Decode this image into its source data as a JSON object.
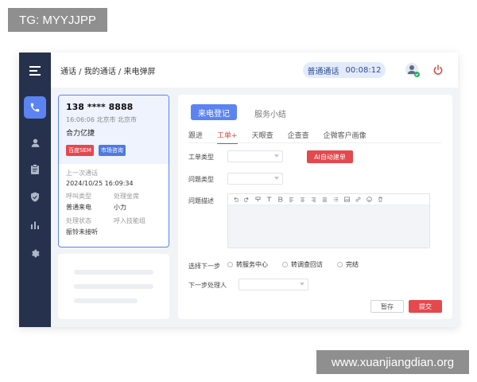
{
  "watermark_top": "TG: MYYJJPP",
  "watermark_bottom": "www.xuanjiangdian.org",
  "topbar": {
    "breadcrumb": "通话 / 我的通话 / 来电弹屏",
    "call_status": "普通通话",
    "call_timer": "00:08:12"
  },
  "sidebar": {
    "icons": [
      "menu-icon",
      "phone-icon",
      "user-icon",
      "clipboard-icon",
      "shield-icon",
      "bar-chart-icon",
      "settings-icon"
    ]
  },
  "caller": {
    "phone": "138 **** 8888",
    "time": "16:06:06",
    "location": "北京市 北京市",
    "company": "合力亿捷",
    "tags": [
      "百度SEM",
      "市场咨询"
    ],
    "last_call_label": "上一次通话",
    "last_call_value": "2024/10/25  16:09:34",
    "call_type_label": "呼叫类型",
    "call_type_value": "普通来电",
    "agent_label": "处理坐席",
    "agent_value": "小力",
    "status_label": "处理状态",
    "status_value": "振铃未接听",
    "skill_group_label": "呼入技能组"
  },
  "main": {
    "tabs": [
      "来电登记",
      "服务小结"
    ],
    "subtabs": [
      "跟进",
      "工单+",
      "天眼查",
      "企查查",
      "企微客户画像"
    ],
    "form": {
      "ticket_type_label": "工单类型",
      "ai_button": "AI自动建单",
      "issue_type_label": "问题类型",
      "issue_desc_label": "问题描述",
      "next_step_label": "选择下一步",
      "next_step_options": [
        "转服务中心",
        "转调查回访",
        "完结"
      ],
      "next_handler_label": "下一步处理人"
    },
    "buttons": {
      "save": "暂存",
      "submit": "提交"
    }
  },
  "colors": {
    "sidebar": "#26324d",
    "accent_blue": "#5b84f2",
    "accent_red": "#e5484d"
  }
}
